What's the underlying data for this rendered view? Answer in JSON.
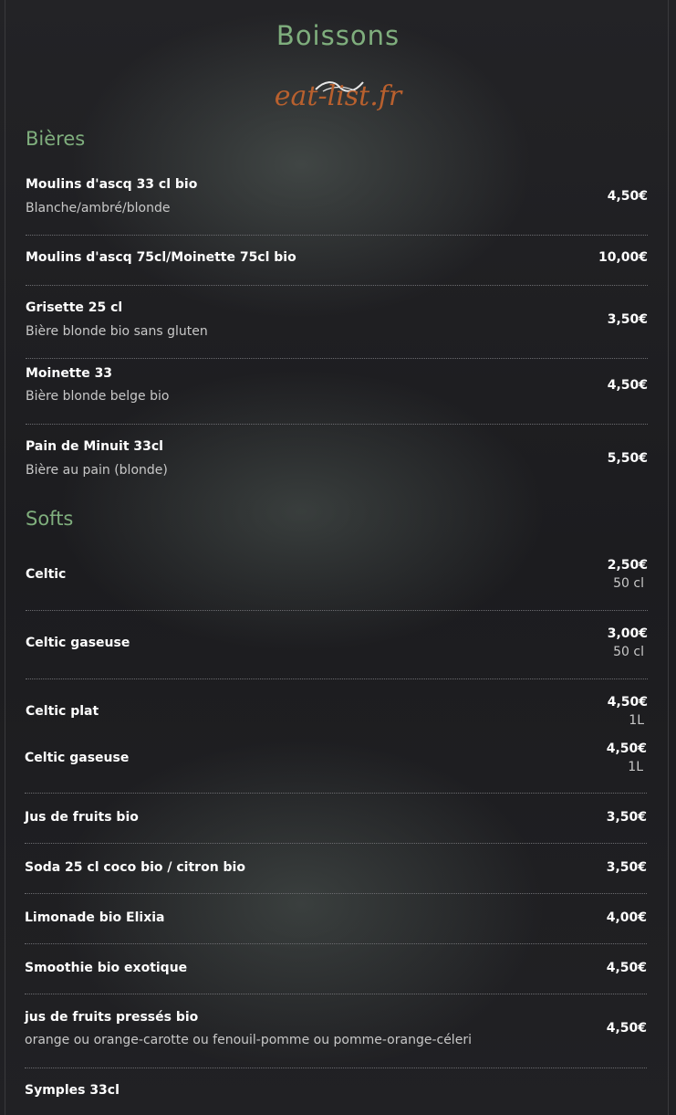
{
  "page_title": "Boissons",
  "logo_text": "eat-list.fr",
  "sections": [
    {
      "title": "Bières",
      "items": [
        {
          "name": "Moulins d'ascq 33 cl bio",
          "desc": "Blanche/ambré/blonde",
          "price": "4,50€"
        },
        {
          "name": "Moulins d'ascq 75cl/Moinette 75cl bio",
          "price": "10,00€"
        },
        {
          "name": "Grisette 25 cl",
          "desc": "Bière blonde bio sans gluten",
          "price": "3,50€"
        },
        {
          "name": "Moinette 33",
          "desc": "Bière blonde belge bio",
          "price": "4,50€"
        },
        {
          "name": "Pain de Minuit 33cl",
          "desc": "Bière au pain (blonde)",
          "price": "5,50€"
        }
      ]
    },
    {
      "title": "Softs",
      "items": [
        {
          "name": "Celtic",
          "price": "2,50€",
          "unit": "50 cl"
        },
        {
          "name": "Celtic gaseuse",
          "price": "3,00€",
          "unit": "50 cl"
        },
        {
          "name": "Celtic plat",
          "price": "4,50€",
          "unit": "1L"
        },
        {
          "name": "Celtic gaseuse",
          "price": "4,50€",
          "unit": "1L"
        },
        {
          "name": "Jus de fruits bio",
          "price": "3,50€"
        },
        {
          "name": "Soda 25 cl coco bio / citron bio",
          "price": "3,50€"
        },
        {
          "name": "Limonade bio Elixia",
          "price": "4,00€"
        },
        {
          "name": "Smoothie bio exotique",
          "price": "4,50€"
        },
        {
          "name": "jus de fruits pressés bio",
          "desc": "orange ou orange-carotte ou fenouil-pomme ou pomme-orange-céleri",
          "price": "4,50€"
        },
        {
          "name": "Symples 33cl"
        }
      ]
    }
  ]
}
